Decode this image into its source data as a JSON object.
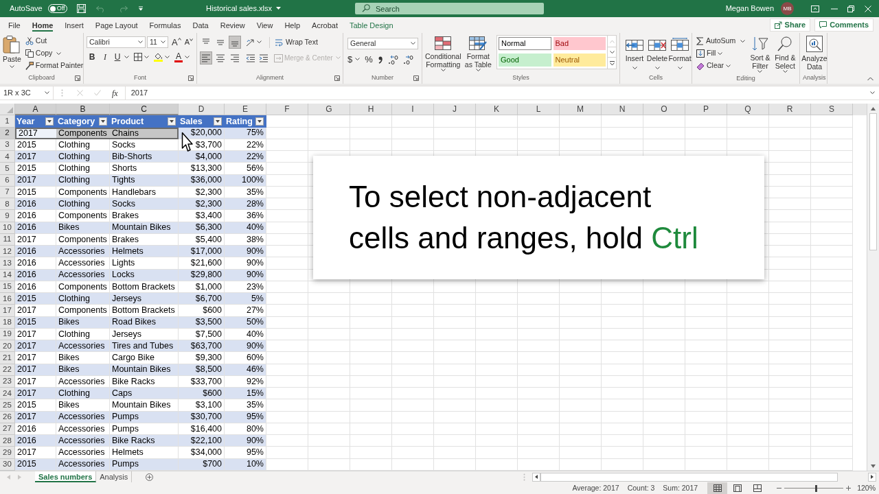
{
  "title_bar": {
    "autosave_label": "AutoSave",
    "autosave_toggle": {
      "label": "Off",
      "on": false
    },
    "file_name": "Historical sales.xlsx",
    "search": {
      "placeholder": "Search"
    },
    "user_name": "Megan Bowen",
    "user_initials": "MB"
  },
  "ribbon_tabs": [
    {
      "label": "File",
      "selected": false,
      "kind": "standard"
    },
    {
      "label": "Home",
      "selected": true,
      "kind": "standard"
    },
    {
      "label": "Insert",
      "selected": false,
      "kind": "standard"
    },
    {
      "label": "Page Layout",
      "selected": false,
      "kind": "standard"
    },
    {
      "label": "Formulas",
      "selected": false,
      "kind": "standard"
    },
    {
      "label": "Data",
      "selected": false,
      "kind": "standard"
    },
    {
      "label": "Review",
      "selected": false,
      "kind": "standard"
    },
    {
      "label": "View",
      "selected": false,
      "kind": "standard"
    },
    {
      "label": "Help",
      "selected": false,
      "kind": "standard"
    },
    {
      "label": "Acrobat",
      "selected": false,
      "kind": "standard"
    },
    {
      "label": "Table Design",
      "selected": false,
      "kind": "contextual"
    }
  ],
  "share_button": "Share",
  "comments_button": "Comments",
  "clipboard": {
    "label": "Clipboard",
    "paste": "Paste",
    "cut": "Cut",
    "copy": "Copy",
    "format_painter": "Format Painter"
  },
  "font": {
    "label": "Font",
    "name": "Calibri",
    "size": "11",
    "grow": "A",
    "shrink": "A",
    "bold": "B",
    "italic": "I",
    "underline": "U",
    "color_button": "A"
  },
  "alignment": {
    "label": "Alignment",
    "wrap_text": "Wrap Text",
    "merge_center": {
      "label": "Merge & Center",
      "disabled": true
    },
    "vertical": [
      {
        "kind": "top",
        "selected": false
      },
      {
        "kind": "middle",
        "selected": false
      },
      {
        "kind": "bottom",
        "selected": true
      }
    ],
    "horizontal": [
      {
        "kind": "left",
        "selected": true
      },
      {
        "kind": "center",
        "selected": false
      },
      {
        "kind": "right",
        "selected": false
      }
    ]
  },
  "number": {
    "label": "Number",
    "format": "General",
    "currency": "$",
    "percent": "%"
  },
  "styles": {
    "label": "Styles",
    "conditional_formatting": "Conditional Formatting",
    "format_as_table": "Format as Table",
    "cell_styles": [
      {
        "label": "Normal",
        "color": "#ffffff"
      },
      {
        "label": "Bad",
        "color": "#ffc7ce"
      },
      {
        "label": "Good",
        "color": "#c6efce"
      },
      {
        "label": "Neutral",
        "color": "#ffeb9c"
      }
    ]
  },
  "cells": {
    "label": "Cells",
    "buttons": [
      {
        "label": "Insert",
        "kind": "insert"
      },
      {
        "label": "Delete",
        "kind": "delete"
      },
      {
        "label": "Format",
        "kind": "format"
      }
    ]
  },
  "editing": {
    "label": "Editing",
    "autosum": "AutoSum",
    "fill": "Fill",
    "clear": "Clear",
    "sort_filter": "Sort & Filter",
    "find_select": "Find & Select"
  },
  "analysis": {
    "label": "Analysis",
    "analyze_data": "Analyze Data"
  },
  "formula_bar": {
    "name_box": "1R x 3C",
    "function_label": "fx",
    "value": "2017"
  },
  "sheet": {
    "columns": [
      {
        "label": "A",
        "selected": true
      },
      {
        "label": "B",
        "selected": true
      },
      {
        "label": "C",
        "selected": true
      },
      {
        "label": "D",
        "selected": false
      },
      {
        "label": "E",
        "selected": false
      },
      {
        "label": "F",
        "selected": false
      },
      {
        "label": "G",
        "selected": false
      },
      {
        "label": "H",
        "selected": false
      },
      {
        "label": "I",
        "selected": false
      },
      {
        "label": "J",
        "selected": false
      },
      {
        "label": "K",
        "selected": false
      },
      {
        "label": "L",
        "selected": false
      },
      {
        "label": "M",
        "selected": false
      },
      {
        "label": "N",
        "selected": false
      },
      {
        "label": "O",
        "selected": false
      },
      {
        "label": "P",
        "selected": false
      },
      {
        "label": "Q",
        "selected": false
      },
      {
        "label": "R",
        "selected": false
      },
      {
        "label": "S",
        "selected": false
      }
    ],
    "header_row": {
      "number": "1",
      "cells": [
        "Year",
        "Category",
        "Product",
        "Sales",
        "Rating"
      ]
    },
    "rows": [
      {
        "number": "2",
        "selected": true,
        "cells": [
          "2017",
          "Components",
          "Chains",
          "$20,000",
          "75%"
        ]
      },
      {
        "number": "3",
        "selected": false,
        "cells": [
          "2015",
          "Clothing",
          "Socks",
          "$3,700",
          "22%"
        ]
      },
      {
        "number": "4",
        "selected": false,
        "cells": [
          "2017",
          "Clothing",
          "Bib-Shorts",
          "$4,000",
          "22%"
        ]
      },
      {
        "number": "5",
        "selected": false,
        "cells": [
          "2015",
          "Clothing",
          "Shorts",
          "$13,300",
          "56%"
        ]
      },
      {
        "number": "6",
        "selected": false,
        "cells": [
          "2017",
          "Clothing",
          "Tights",
          "$36,000",
          "100%"
        ]
      },
      {
        "number": "7",
        "selected": false,
        "cells": [
          "2015",
          "Components",
          "Handlebars",
          "$2,300",
          "35%"
        ]
      },
      {
        "number": "8",
        "selected": false,
        "cells": [
          "2016",
          "Clothing",
          "Socks",
          "$2,300",
          "28%"
        ]
      },
      {
        "number": "9",
        "selected": false,
        "cells": [
          "2016",
          "Components",
          "Brakes",
          "$3,400",
          "36%"
        ]
      },
      {
        "number": "10",
        "selected": false,
        "cells": [
          "2016",
          "Bikes",
          "Mountain Bikes",
          "$6,300",
          "40%"
        ]
      },
      {
        "number": "11",
        "selected": false,
        "cells": [
          "2017",
          "Components",
          "Brakes",
          "$5,400",
          "38%"
        ]
      },
      {
        "number": "12",
        "selected": false,
        "cells": [
          "2016",
          "Accessories",
          "Helmets",
          "$17,000",
          "90%"
        ]
      },
      {
        "number": "13",
        "selected": false,
        "cells": [
          "2016",
          "Accessories",
          "Lights",
          "$21,600",
          "90%"
        ]
      },
      {
        "number": "14",
        "selected": false,
        "cells": [
          "2016",
          "Accessories",
          "Locks",
          "$29,800",
          "90%"
        ]
      },
      {
        "number": "15",
        "selected": false,
        "cells": [
          "2016",
          "Components",
          "Bottom Brackets",
          "$1,000",
          "23%"
        ]
      },
      {
        "number": "16",
        "selected": false,
        "cells": [
          "2015",
          "Clothing",
          "Jerseys",
          "$6,700",
          "5%"
        ]
      },
      {
        "number": "17",
        "selected": false,
        "cells": [
          "2017",
          "Components",
          "Bottom Brackets",
          "$600",
          "27%"
        ]
      },
      {
        "number": "18",
        "selected": false,
        "cells": [
          "2015",
          "Bikes",
          "Road Bikes",
          "$3,500",
          "50%"
        ]
      },
      {
        "number": "19",
        "selected": false,
        "cells": [
          "2017",
          "Clothing",
          "Jerseys",
          "$7,500",
          "40%"
        ]
      },
      {
        "number": "20",
        "selected": false,
        "cells": [
          "2017",
          "Accessories",
          "Tires and Tubes",
          "$63,700",
          "90%"
        ]
      },
      {
        "number": "21",
        "selected": false,
        "cells": [
          "2017",
          "Bikes",
          "Cargo Bike",
          "$9,300",
          "60%"
        ]
      },
      {
        "number": "22",
        "selected": false,
        "cells": [
          "2017",
          "Bikes",
          "Mountain Bikes",
          "$8,500",
          "46%"
        ]
      },
      {
        "number": "23",
        "selected": false,
        "cells": [
          "2017",
          "Accessories",
          "Bike Racks",
          "$33,700",
          "92%"
        ]
      },
      {
        "number": "24",
        "selected": false,
        "cells": [
          "2017",
          "Clothing",
          "Caps",
          "$600",
          "15%"
        ]
      },
      {
        "number": "25",
        "selected": false,
        "cells": [
          "2015",
          "Bikes",
          "Mountain Bikes",
          "$3,100",
          "35%"
        ]
      },
      {
        "number": "26",
        "selected": false,
        "cells": [
          "2017",
          "Accessories",
          "Pumps",
          "$30,700",
          "95%"
        ]
      },
      {
        "number": "27",
        "selected": false,
        "cells": [
          "2016",
          "Accessories",
          "Pumps",
          "$16,400",
          "80%"
        ]
      },
      {
        "number": "28",
        "selected": false,
        "cells": [
          "2016",
          "Accessories",
          "Bike Racks",
          "$22,100",
          "90%"
        ]
      },
      {
        "number": "29",
        "selected": false,
        "cells": [
          "2017",
          "Accessories",
          "Helmets",
          "$34,000",
          "95%"
        ]
      },
      {
        "number": "30",
        "selected": false,
        "cells": [
          "2015",
          "Accessories",
          "Pumps",
          "$700",
          "10%"
        ]
      }
    ]
  },
  "callout": {
    "text": "To select non-adjacent cells and ranges, hold",
    "key": "Ctrl"
  },
  "sheet_tabs": [
    {
      "label": "Sales numbers",
      "selected": true
    },
    {
      "label": "Analysis",
      "selected": false
    }
  ],
  "status_bar": {
    "average": "Average: 2017",
    "count": "Count: 3",
    "sum": "Sum: 2017",
    "views": [
      {
        "kind": "normal",
        "selected": true
      },
      {
        "kind": "page_layout",
        "selected": false
      },
      {
        "kind": "page_break",
        "selected": false
      }
    ],
    "zoom": {
      "level": 0.54,
      "reading": "120%"
    }
  }
}
